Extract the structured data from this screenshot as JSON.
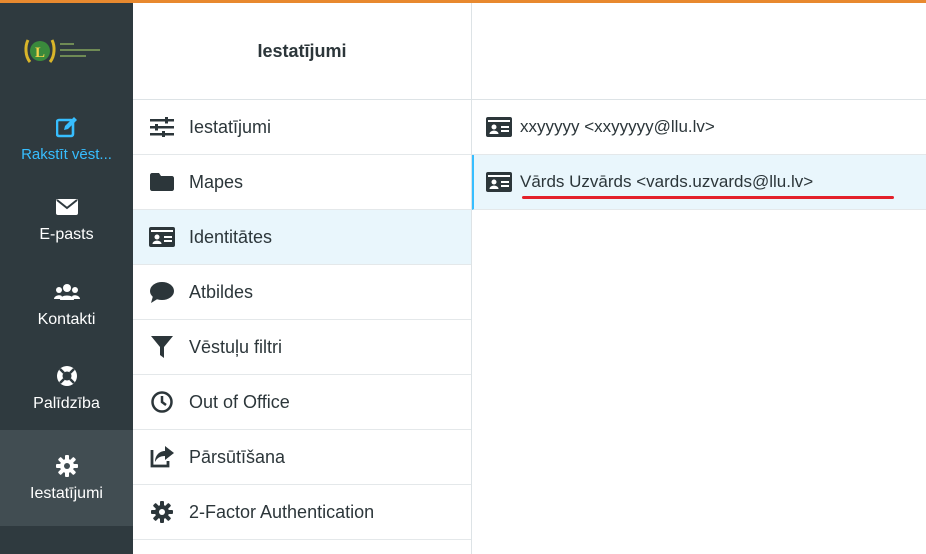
{
  "nav": {
    "logo_name": "llu-logo",
    "items": [
      {
        "label": "Rakstīt vēst...",
        "icon": "edit-icon"
      },
      {
        "label": "E-pasts",
        "icon": "envelope-icon"
      },
      {
        "label": "Kontakti",
        "icon": "users-icon"
      },
      {
        "label": "Palīdzība",
        "icon": "lifebuoy-icon"
      },
      {
        "label": "Iestatījumi",
        "icon": "gear-icon"
      }
    ]
  },
  "settings": {
    "title": "Iestatījumi",
    "items": [
      {
        "label": "Iestatījumi",
        "icon": "sliders-icon"
      },
      {
        "label": "Mapes",
        "icon": "folder-icon"
      },
      {
        "label": "Identitātes",
        "icon": "id-card-icon"
      },
      {
        "label": "Atbildes",
        "icon": "comment-icon"
      },
      {
        "label": "Vēstuļu filtri",
        "icon": "filter-icon"
      },
      {
        "label": "Out of Office",
        "icon": "clock-icon"
      },
      {
        "label": "Pārsūtīšana",
        "icon": "share-icon"
      },
      {
        "label": "2-Factor Authentication",
        "icon": "gear-icon"
      }
    ]
  },
  "identities": {
    "items": [
      {
        "label": "xxyyyyy <xxyyyyy@llu.lv>",
        "icon": "id-card-icon"
      },
      {
        "label": "Vārds Uzvārds <vards.uzvards@llu.lv>",
        "icon": "id-card-icon"
      }
    ]
  },
  "colors": {
    "nav_bg": "#2f3a3f",
    "accent": "#37beff",
    "selected_bg": "#e9f6fc",
    "annotation": "#e3202a",
    "top_border": "#e8892f"
  }
}
